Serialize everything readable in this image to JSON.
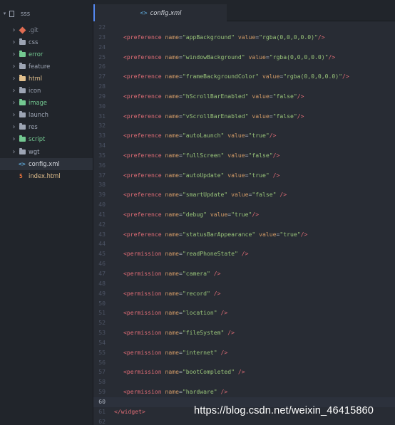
{
  "sidebar": {
    "project": "sss",
    "items": [
      {
        "label": ".git",
        "kind": "git",
        "expandable": true,
        "color": "#e06c52"
      },
      {
        "label": "css",
        "kind": "folder",
        "expandable": true,
        "color": "#9da5b4"
      },
      {
        "label": "error",
        "kind": "folder",
        "expandable": true,
        "color": "#73c991",
        "label_color": "#73c991"
      },
      {
        "label": "feature",
        "kind": "folder",
        "expandable": true,
        "color": "#9da5b4"
      },
      {
        "label": "html",
        "kind": "folder",
        "expandable": true,
        "color": "#e2c08d",
        "label_color": "#e2c08d"
      },
      {
        "label": "icon",
        "kind": "folder",
        "expandable": true,
        "color": "#9da5b4"
      },
      {
        "label": "image",
        "kind": "folder",
        "expandable": true,
        "color": "#73c991",
        "label_color": "#73c991"
      },
      {
        "label": "launch",
        "kind": "folder",
        "expandable": true,
        "color": "#9da5b4"
      },
      {
        "label": "res",
        "kind": "folder",
        "expandable": true,
        "color": "#9da5b4"
      },
      {
        "label": "script",
        "kind": "folder",
        "expandable": true,
        "color": "#73c991",
        "label_color": "#73c991"
      },
      {
        "label": "wgt",
        "kind": "folder",
        "expandable": true,
        "color": "#9da5b4"
      },
      {
        "label": "config.xml",
        "kind": "xml",
        "expandable": false,
        "selected": true
      },
      {
        "label": "index.html",
        "kind": "html",
        "expandable": false,
        "label_color": "#e2c08d"
      }
    ]
  },
  "editor": {
    "tab": {
      "label": "config.xml",
      "icon": "xml-icon"
    },
    "current_line": "60",
    "lines": [
      {
        "n": "22",
        "tokens": []
      },
      {
        "n": "23",
        "tokens": [
          [
            "t-tag",
            "<preference"
          ],
          [
            "t-punct",
            " "
          ],
          [
            "t-attr",
            "name"
          ],
          [
            "t-punct",
            "="
          ],
          [
            "t-str",
            "\"appBackground\""
          ],
          [
            "t-punct",
            " "
          ],
          [
            "t-attr",
            "value"
          ],
          [
            "t-punct",
            "="
          ],
          [
            "t-str",
            "\"rgba(0,0,0,0.0)\""
          ],
          [
            "t-tag",
            "/>"
          ]
        ]
      },
      {
        "n": "24",
        "tokens": []
      },
      {
        "n": "25",
        "tokens": [
          [
            "t-tag",
            "<preference"
          ],
          [
            "t-punct",
            " "
          ],
          [
            "t-attr",
            "name"
          ],
          [
            "t-punct",
            "="
          ],
          [
            "t-str",
            "\"windowBackground\""
          ],
          [
            "t-punct",
            " "
          ],
          [
            "t-attr",
            "value"
          ],
          [
            "t-punct",
            "="
          ],
          [
            "t-str",
            "\"rgba(0,0,0,0.0)\""
          ],
          [
            "t-tag",
            "/>"
          ]
        ]
      },
      {
        "n": "26",
        "tokens": []
      },
      {
        "n": "27",
        "tokens": [
          [
            "t-tag",
            "<preference"
          ],
          [
            "t-punct",
            " "
          ],
          [
            "t-attr",
            "name"
          ],
          [
            "t-punct",
            "="
          ],
          [
            "t-str",
            "\"frameBackgroundColor\""
          ],
          [
            "t-punct",
            " "
          ],
          [
            "t-attr",
            "value"
          ],
          [
            "t-punct",
            "="
          ],
          [
            "t-str",
            "\"rgba(0,0,0,0.0)\""
          ],
          [
            "t-tag",
            "/>"
          ]
        ]
      },
      {
        "n": "28",
        "tokens": []
      },
      {
        "n": "29",
        "tokens": [
          [
            "t-tag",
            "<preference"
          ],
          [
            "t-punct",
            " "
          ],
          [
            "t-attr",
            "name"
          ],
          [
            "t-punct",
            "="
          ],
          [
            "t-str",
            "\"hScrollBarEnabled\""
          ],
          [
            "t-punct",
            " "
          ],
          [
            "t-attr",
            "value"
          ],
          [
            "t-punct",
            "="
          ],
          [
            "t-str",
            "\"false\""
          ],
          [
            "t-tag",
            "/>"
          ]
        ]
      },
      {
        "n": "30",
        "tokens": []
      },
      {
        "n": "31",
        "tokens": [
          [
            "t-tag",
            "<preference"
          ],
          [
            "t-punct",
            " "
          ],
          [
            "t-attr",
            "name"
          ],
          [
            "t-punct",
            "="
          ],
          [
            "t-str",
            "\"vScrollBarEnabled\""
          ],
          [
            "t-punct",
            " "
          ],
          [
            "t-attr",
            "value"
          ],
          [
            "t-punct",
            "="
          ],
          [
            "t-str",
            "\"false\""
          ],
          [
            "t-tag",
            "/>"
          ]
        ]
      },
      {
        "n": "32",
        "tokens": []
      },
      {
        "n": "33",
        "tokens": [
          [
            "t-tag",
            "<preference"
          ],
          [
            "t-punct",
            " "
          ],
          [
            "t-attr",
            "name"
          ],
          [
            "t-punct",
            "="
          ],
          [
            "t-str",
            "\"autoLaunch\""
          ],
          [
            "t-punct",
            " "
          ],
          [
            "t-attr",
            "value"
          ],
          [
            "t-punct",
            "="
          ],
          [
            "t-str",
            "\"true\""
          ],
          [
            "t-tag",
            "/>"
          ]
        ]
      },
      {
        "n": "34",
        "tokens": []
      },
      {
        "n": "35",
        "tokens": [
          [
            "t-tag",
            "<preference"
          ],
          [
            "t-punct",
            " "
          ],
          [
            "t-attr",
            "name"
          ],
          [
            "t-punct",
            "="
          ],
          [
            "t-str",
            "\"fullScreen\""
          ],
          [
            "t-punct",
            " "
          ],
          [
            "t-attr",
            "value"
          ],
          [
            "t-punct",
            "="
          ],
          [
            "t-str",
            "\"false\""
          ],
          [
            "t-tag",
            "/>"
          ]
        ]
      },
      {
        "n": "36",
        "tokens": []
      },
      {
        "n": "37",
        "tokens": [
          [
            "t-tag",
            "<preference"
          ],
          [
            "t-punct",
            " "
          ],
          [
            "t-attr",
            "name"
          ],
          [
            "t-punct",
            "="
          ],
          [
            "t-str",
            "\"autoUpdate\""
          ],
          [
            "t-punct",
            " "
          ],
          [
            "t-attr",
            "value"
          ],
          [
            "t-punct",
            "="
          ],
          [
            "t-str",
            "\"true\""
          ],
          [
            "t-punct",
            " "
          ],
          [
            "t-tag",
            "/>"
          ]
        ]
      },
      {
        "n": "38",
        "tokens": []
      },
      {
        "n": "39",
        "tokens": [
          [
            "t-tag",
            "<preference"
          ],
          [
            "t-punct",
            " "
          ],
          [
            "t-attr",
            "name"
          ],
          [
            "t-punct",
            "="
          ],
          [
            "t-str",
            "\"smartUpdate\""
          ],
          [
            "t-punct",
            " "
          ],
          [
            "t-attr",
            "value"
          ],
          [
            "t-punct",
            "="
          ],
          [
            "t-str",
            "\"false\""
          ],
          [
            "t-punct",
            " "
          ],
          [
            "t-tag",
            "/>"
          ]
        ]
      },
      {
        "n": "40",
        "tokens": []
      },
      {
        "n": "41",
        "tokens": [
          [
            "t-tag",
            "<preference"
          ],
          [
            "t-punct",
            " "
          ],
          [
            "t-attr",
            "name"
          ],
          [
            "t-punct",
            "="
          ],
          [
            "t-str",
            "\"debug\""
          ],
          [
            "t-punct",
            " "
          ],
          [
            "t-attr",
            "value"
          ],
          [
            "t-punct",
            "="
          ],
          [
            "t-str",
            "\"true\""
          ],
          [
            "t-tag",
            "/>"
          ]
        ]
      },
      {
        "n": "42",
        "tokens": []
      },
      {
        "n": "43",
        "tokens": [
          [
            "t-tag",
            "<preference"
          ],
          [
            "t-punct",
            " "
          ],
          [
            "t-attr",
            "name"
          ],
          [
            "t-punct",
            "="
          ],
          [
            "t-str",
            "\"statusBarAppearance\""
          ],
          [
            "t-punct",
            " "
          ],
          [
            "t-attr",
            "value"
          ],
          [
            "t-punct",
            "="
          ],
          [
            "t-str",
            "\"true\""
          ],
          [
            "t-tag",
            "/>"
          ]
        ]
      },
      {
        "n": "44",
        "tokens": []
      },
      {
        "n": "45",
        "tokens": [
          [
            "t-tag",
            "<permission"
          ],
          [
            "t-punct",
            " "
          ],
          [
            "t-attr",
            "name"
          ],
          [
            "t-punct",
            "="
          ],
          [
            "t-str",
            "\"readPhoneState\""
          ],
          [
            "t-punct",
            " "
          ],
          [
            "t-tag",
            "/>"
          ]
        ]
      },
      {
        "n": "46",
        "tokens": []
      },
      {
        "n": "47",
        "tokens": [
          [
            "t-tag",
            "<permission"
          ],
          [
            "t-punct",
            " "
          ],
          [
            "t-attr",
            "name"
          ],
          [
            "t-punct",
            "="
          ],
          [
            "t-str",
            "\"camera\""
          ],
          [
            "t-punct",
            " "
          ],
          [
            "t-tag",
            "/>"
          ]
        ]
      },
      {
        "n": "48",
        "tokens": []
      },
      {
        "n": "49",
        "tokens": [
          [
            "t-tag",
            "<permission"
          ],
          [
            "t-punct",
            " "
          ],
          [
            "t-attr",
            "name"
          ],
          [
            "t-punct",
            "="
          ],
          [
            "t-str",
            "\"record\""
          ],
          [
            "t-punct",
            " "
          ],
          [
            "t-tag",
            "/>"
          ]
        ]
      },
      {
        "n": "50",
        "tokens": []
      },
      {
        "n": "51",
        "tokens": [
          [
            "t-tag",
            "<permission"
          ],
          [
            "t-punct",
            " "
          ],
          [
            "t-attr",
            "name"
          ],
          [
            "t-punct",
            "="
          ],
          [
            "t-str",
            "\"location\""
          ],
          [
            "t-punct",
            " "
          ],
          [
            "t-tag",
            "/>"
          ]
        ]
      },
      {
        "n": "52",
        "tokens": []
      },
      {
        "n": "53",
        "tokens": [
          [
            "t-tag",
            "<permission"
          ],
          [
            "t-punct",
            " "
          ],
          [
            "t-attr",
            "name"
          ],
          [
            "t-punct",
            "="
          ],
          [
            "t-str",
            "\"fileSystem\""
          ],
          [
            "t-punct",
            " "
          ],
          [
            "t-tag",
            "/>"
          ]
        ]
      },
      {
        "n": "54",
        "tokens": []
      },
      {
        "n": "55",
        "tokens": [
          [
            "t-tag",
            "<permission"
          ],
          [
            "t-punct",
            " "
          ],
          [
            "t-attr",
            "name"
          ],
          [
            "t-punct",
            "="
          ],
          [
            "t-str",
            "\"internet\""
          ],
          [
            "t-punct",
            " "
          ],
          [
            "t-tag",
            "/>"
          ]
        ]
      },
      {
        "n": "56",
        "tokens": []
      },
      {
        "n": "57",
        "tokens": [
          [
            "t-tag",
            "<permission"
          ],
          [
            "t-punct",
            " "
          ],
          [
            "t-attr",
            "name"
          ],
          [
            "t-punct",
            "="
          ],
          [
            "t-str",
            "\"bootCompleted\""
          ],
          [
            "t-punct",
            " "
          ],
          [
            "t-tag",
            "/>"
          ]
        ]
      },
      {
        "n": "58",
        "tokens": []
      },
      {
        "n": "59",
        "tokens": [
          [
            "t-tag",
            "<permission"
          ],
          [
            "t-punct",
            " "
          ],
          [
            "t-attr",
            "name"
          ],
          [
            "t-punct",
            "="
          ],
          [
            "t-str",
            "\"hardware\""
          ],
          [
            "t-punct",
            " "
          ],
          [
            "t-tag",
            "/>"
          ]
        ]
      },
      {
        "n": "60",
        "tokens": []
      },
      {
        "n": "61",
        "tokens": [
          [
            "t-tag",
            "</widget>"
          ]
        ],
        "indent": false
      },
      {
        "n": "62",
        "tokens": []
      }
    ]
  },
  "watermark": "https://blog.csdn.net/weixin_46415860"
}
